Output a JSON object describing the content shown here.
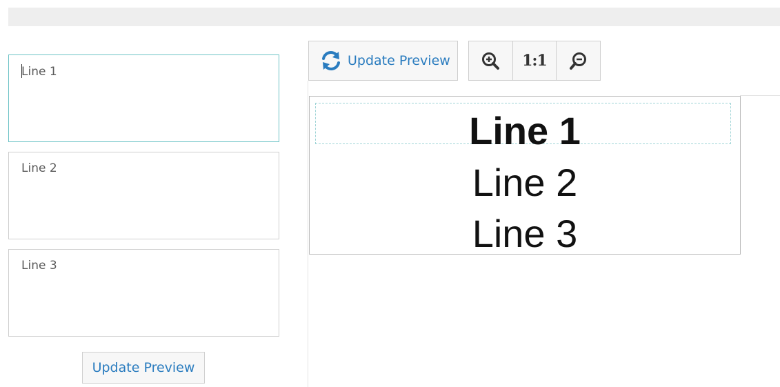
{
  "editor": {
    "lines": [
      {
        "value": "Line 1"
      },
      {
        "value": "Line 2"
      },
      {
        "value": "Line 3"
      }
    ],
    "update_preview_label": "Update Preview"
  },
  "toolbar": {
    "update_preview_label": "Update Preview",
    "refresh_icon": "refresh-icon",
    "zoom_in_icon": "zoom-in-icon",
    "actual_size_label": "1:1",
    "zoom_out_icon": "zoom-out-icon"
  },
  "preview": {
    "lines": [
      "Line 1",
      "Line 2",
      "Line 3"
    ],
    "selected_line": 1
  },
  "colors": {
    "accent": "#2a7cbf",
    "focus_border": "#6cc3c6",
    "selection_dash": "#9fd4d6"
  }
}
